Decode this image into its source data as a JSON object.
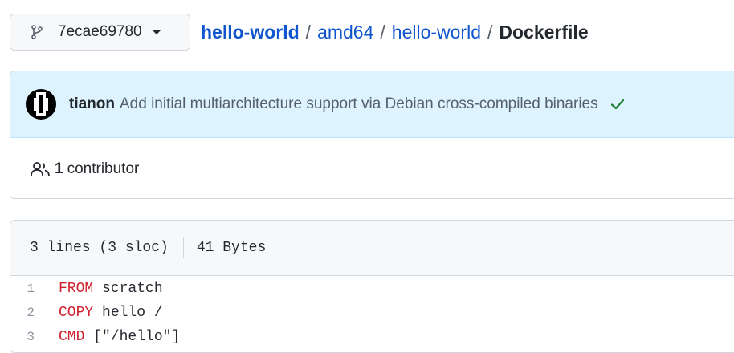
{
  "branch": {
    "label": "7ecae69780"
  },
  "breadcrumb": {
    "repo": "hello-world",
    "dir1": "amd64",
    "dir2": "hello-world",
    "file": "Dockerfile",
    "separator": "/"
  },
  "commit": {
    "author": "tianon",
    "message": "Add initial multiarchitecture support via Debian cross-compiled binaries",
    "status_color": "#1a7f37"
  },
  "contributors": {
    "count": "1",
    "label": "contributor"
  },
  "file": {
    "lines_info": "3 lines (3 sloc)",
    "size": "41 Bytes",
    "code": [
      {
        "num": "1",
        "keyword": "FROM",
        "rest": " scratch"
      },
      {
        "num": "2",
        "keyword": "COPY",
        "rest": " hello /"
      },
      {
        "num": "3",
        "keyword": "CMD",
        "rest": " [\"/hello\"]"
      }
    ]
  },
  "colors": {
    "link": "#0f55cf",
    "keyword": "#cf222e",
    "commit_bg": "#ddf4ff"
  }
}
